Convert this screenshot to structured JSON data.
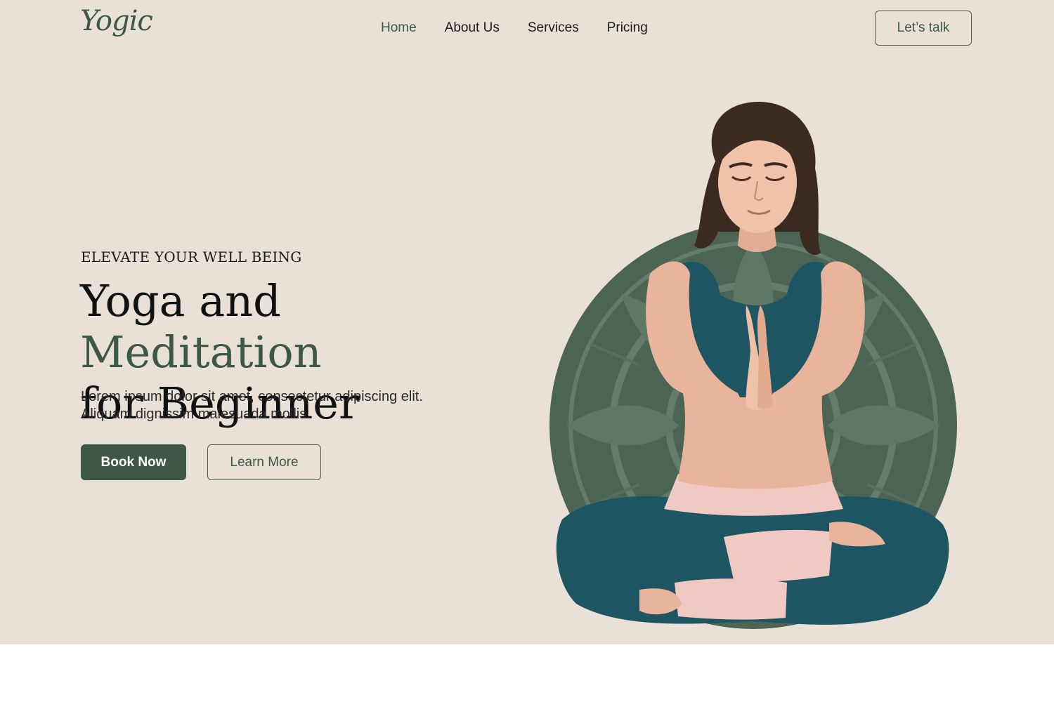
{
  "brand": {
    "logo_text": "Yogic"
  },
  "nav": {
    "items": [
      {
        "label": "Home",
        "active": true
      },
      {
        "label": "About Us",
        "active": false
      },
      {
        "label": "Services",
        "active": false
      },
      {
        "label": "Pricing",
        "active": false
      }
    ],
    "cta_label": "Let’s talk"
  },
  "hero": {
    "eyebrow": "ELEVATE YOUR WELL BEING",
    "headline_part1": "Yoga and ",
    "headline_accent": "Meditation",
    "headline_part2": "for Beginner",
    "lead_line1": "Lorem ipsum dolor sit amet, consectetur adipiscing elit.",
    "lead_line2": "Aliquam dignissim malesuada mollis.",
    "primary_button": "Book Now",
    "secondary_button": "Learn More"
  },
  "colors": {
    "background": "#e9e1d7",
    "accent": "#3e5848",
    "circle": "#4c6453",
    "outfit": "#1d5563",
    "pants_accent": "#f1c9c3"
  }
}
